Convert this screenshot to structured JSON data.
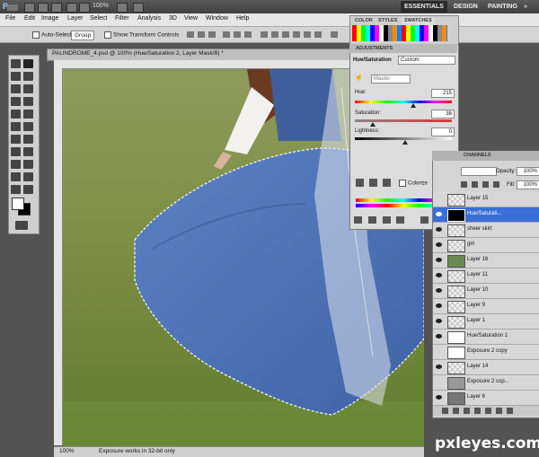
{
  "app": {
    "logo": "Ps",
    "zoom": "100%"
  },
  "workspaces": [
    "ESSENTIALS",
    "DESIGN",
    "PAINTING",
    "»"
  ],
  "menu": [
    "File",
    "Edit",
    "Image",
    "Layer",
    "Select",
    "Filter",
    "Analysis",
    "3D",
    "View",
    "Window",
    "Help"
  ],
  "options": {
    "auto_select": "Auto-Select:",
    "group": "Group",
    "show_transform": "Show Transform Controls"
  },
  "document": {
    "title": "PALINDROME_4.psd @ 100% (Hue/Saturation 2, Layer Mask/8) *",
    "zoom": "100%",
    "status": "Exposure works in 32-bit only"
  },
  "swatches": {
    "tabs": [
      "COLOR",
      "STYLES",
      "SWATCHES"
    ]
  },
  "adjustments": {
    "tab": "ADJUSTMENTS",
    "title": "Hue/Saturation",
    "preset": "Custom",
    "channel": "Master",
    "hue_label": "Hue:",
    "hue_value": "215",
    "sat_label": "Saturation:",
    "sat_value": "38",
    "light_label": "Lightness:",
    "light_value": "0",
    "colorize": "Colorize"
  },
  "layers": {
    "tab": "CHANNELS",
    "opacity_label": "Opacity:",
    "opacity": "100%",
    "fill_label": "Fill:",
    "fill": "100%",
    "items": [
      {
        "name": "Layer 15",
        "selected": false
      },
      {
        "name": "Hue/Saturati...",
        "selected": true
      },
      {
        "name": "sheer skirt",
        "selected": false
      },
      {
        "name": "girl",
        "selected": false
      },
      {
        "name": "Layer 16",
        "selected": false
      },
      {
        "name": "Layer 11",
        "selected": false
      },
      {
        "name": "Layer 10",
        "selected": false
      },
      {
        "name": "Layer 9",
        "selected": false
      },
      {
        "name": "Layer 1",
        "selected": false
      },
      {
        "name": "Hue/Saturation 1",
        "selected": false
      },
      {
        "name": "Exposure 2 copy",
        "selected": false
      },
      {
        "name": "Layer 14",
        "selected": false
      },
      {
        "name": "Exposure 2 cop...",
        "selected": false
      },
      {
        "name": "Layer 6",
        "selected": false
      }
    ]
  },
  "watermark": "pxleyes.com"
}
